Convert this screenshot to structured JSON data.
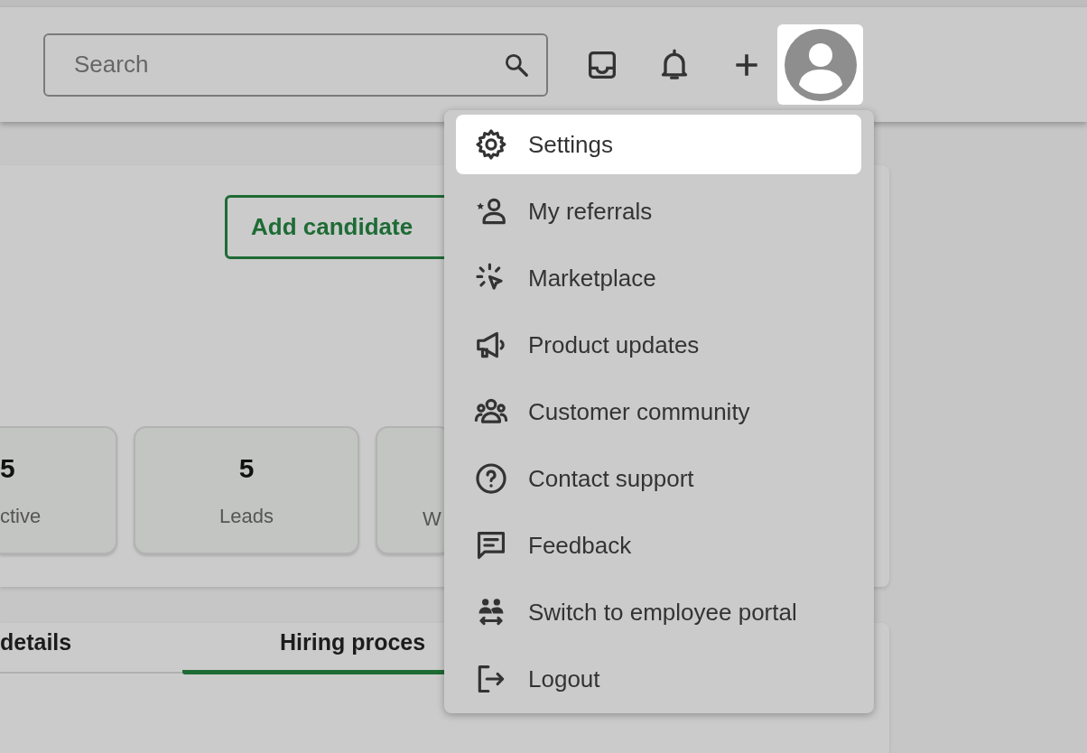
{
  "header": {
    "search": {
      "placeholder": "Search"
    }
  },
  "add_candidate_button": "Add candidate",
  "stats": [
    {
      "value": "5",
      "label": "ctive"
    },
    {
      "value": "5",
      "label": "Leads"
    },
    {
      "label": "W"
    }
  ],
  "tabs": [
    {
      "label": "details",
      "selected": false
    },
    {
      "label": "Hiring proces",
      "selected": true
    }
  ],
  "user_menu": {
    "items": [
      {
        "label": "Settings",
        "selected": true
      },
      {
        "label": "My referrals",
        "selected": false
      },
      {
        "label": "Marketplace",
        "selected": false
      },
      {
        "label": "Product updates",
        "selected": false
      },
      {
        "label": "Customer community",
        "selected": false
      },
      {
        "label": "Contact support",
        "selected": false
      },
      {
        "label": "Feedback",
        "selected": false
      },
      {
        "label": "Switch to employee portal",
        "selected": false
      },
      {
        "label": "Logout",
        "selected": false
      }
    ]
  }
}
